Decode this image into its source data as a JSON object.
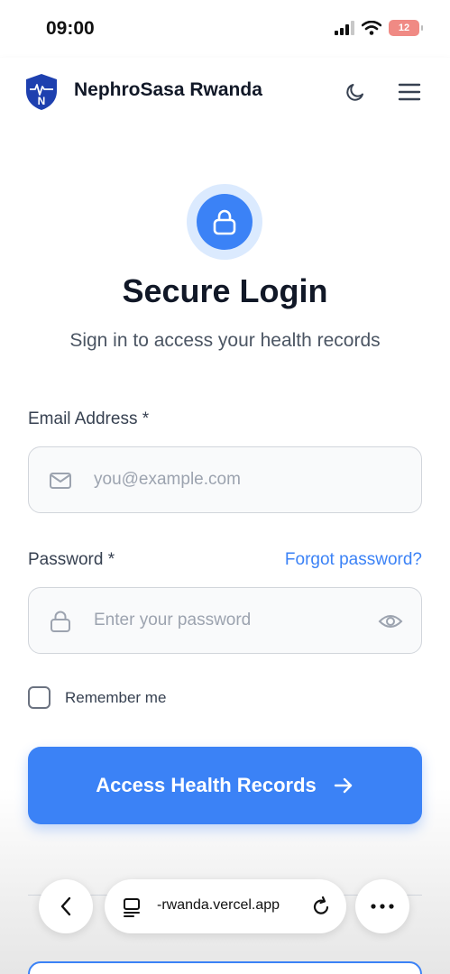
{
  "status_bar": {
    "time": "09:00",
    "battery": "12",
    "icons": [
      "signal-icon",
      "wifi-icon",
      "battery-icon"
    ]
  },
  "header": {
    "app_name": "NephroSasa Rwanda",
    "logo_letter": "N",
    "icons": [
      "shield-logo",
      "moon-icon",
      "hamburger-menu-icon"
    ]
  },
  "login": {
    "title": "Secure Login",
    "subtitle": "Sign in to access your health records",
    "email_label": "Email Address *",
    "email_placeholder": "you@example.com",
    "email_value": "",
    "password_label": "Password *",
    "forgot_password": "Forgot password?",
    "password_placeholder": "Enter your password",
    "password_value": "",
    "remember_me": "Remember me",
    "remember_checked": false,
    "submit_label": "Access Health Records"
  },
  "browser": {
    "url": "-rwanda.vercel.app",
    "icons": [
      "back-arrow-icon",
      "tabs-icon",
      "reload-icon",
      "more-dots-icon"
    ]
  },
  "colors": {
    "accent": "#3b82f6",
    "accent_light": "#dbeafe",
    "brand_dark": "#1e40af",
    "title_text": "#111827"
  }
}
